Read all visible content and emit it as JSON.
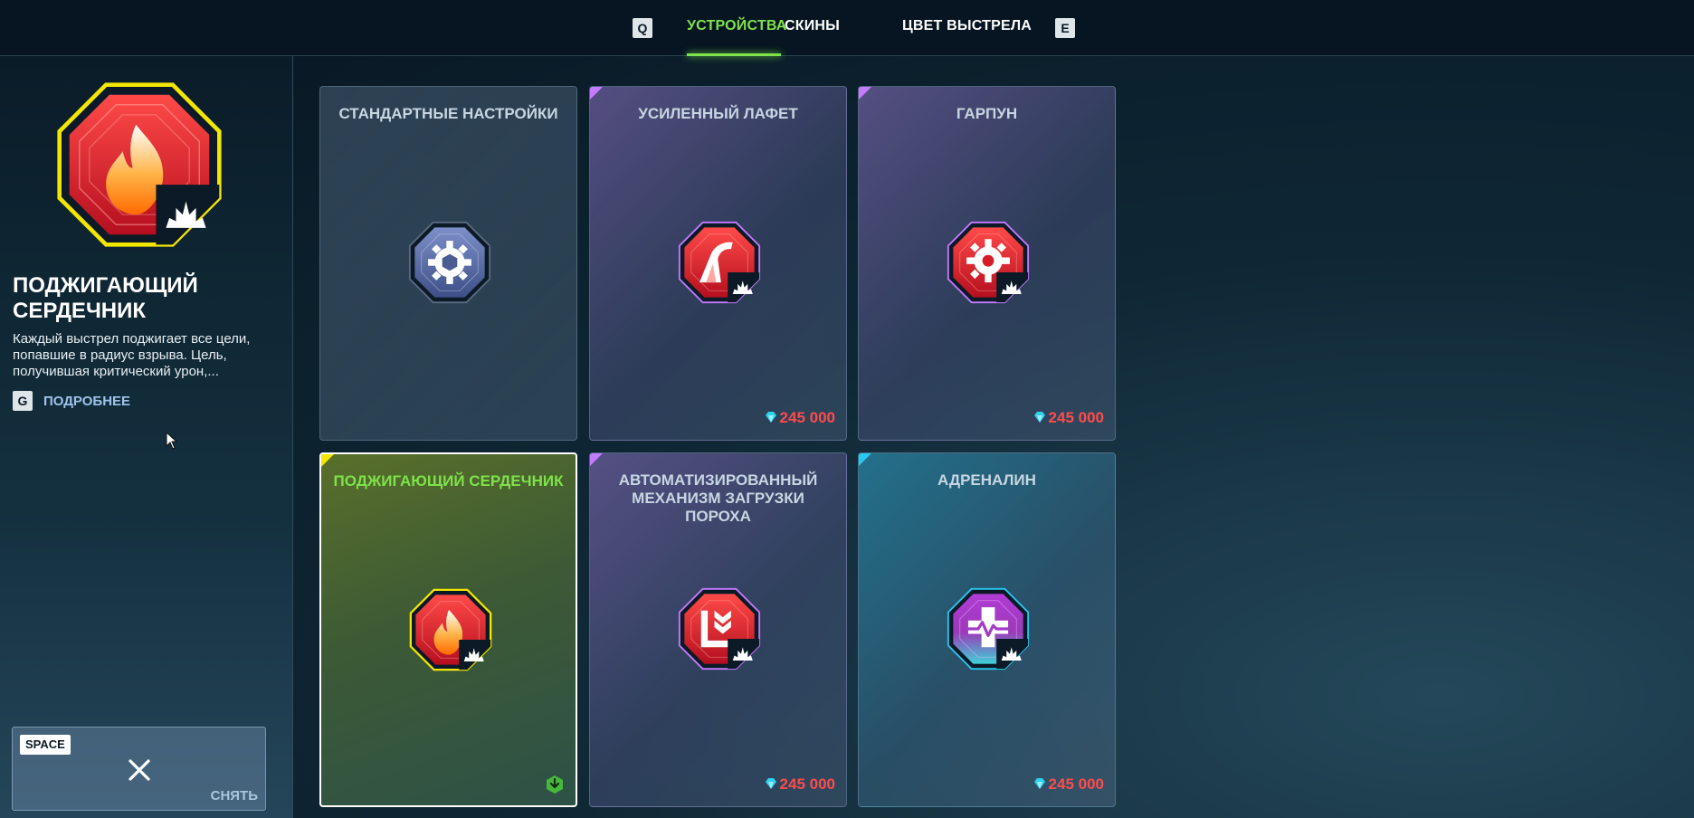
{
  "nav": {
    "left_key": "Q",
    "right_key": "E",
    "tabs": [
      {
        "label": "УСТРОЙСТВА",
        "active": true
      },
      {
        "label": "СКИНЫ",
        "active": false
      },
      {
        "label": "ЦВЕТ ВЫСТРЕЛА",
        "active": false
      }
    ]
  },
  "selected_item": {
    "icon": "fire-augment-icon",
    "title": "ПОДЖИГАЮЩИЙ СЕРДЕЧНИК",
    "description": "Каждый выстрел поджигает все цели, попавшие в радиус взрыва. Цель, получившая критический урон,...",
    "more_key": "G",
    "more_label": "ПОДРОБНЕЕ"
  },
  "remove": {
    "key": "SPACE",
    "label": "СНЯТЬ",
    "icon": "close-icon"
  },
  "cards": [
    {
      "title": "СТАНДАРТНЫЕ НАСТРОЙКИ",
      "icon": "standard-gear-icon",
      "price": ""
    },
    {
      "title": "УСИЛЕННЫЙ ЛАФЕТ",
      "icon": "reinforced-mount-icon",
      "price": "245 000"
    },
    {
      "title": "ГАРПУН",
      "icon": "harpoon-gear-icon",
      "price": "245 000"
    },
    {
      "title": "ПОДЖИГАЮЩИЙ СЕРДЕЧНИК",
      "icon": "fire-augment-icon",
      "price": "",
      "equipped": true
    },
    {
      "title": "АВТОМАТИЗИРОВАННЫЙ МЕХАНИЗМ ЗАГРУЗКИ ПОРОХА",
      "icon": "auto-loader-icon",
      "price": "245 000"
    },
    {
      "title": "АДРЕНАЛИН",
      "icon": "adrenaline-icon",
      "price": "245 000"
    }
  ],
  "colors": {
    "accent_green": "#7ee24a",
    "price_red": "#ff4b4b",
    "rarity_purple": "#c57bff",
    "rarity_yellow": "#f3e600",
    "rarity_cyan": "#29c8f0",
    "gem_cyan": "#2fd2ee"
  }
}
